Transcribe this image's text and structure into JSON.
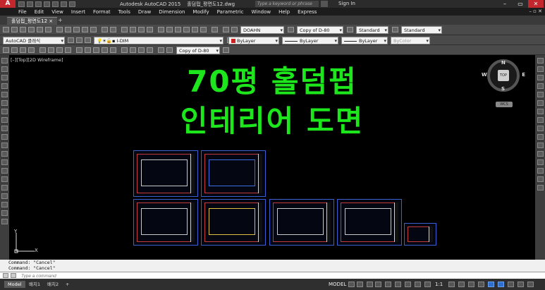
{
  "window": {
    "logo": "A",
    "app_title": "Autodesk AutoCAD 2015",
    "file_name": "홀덤펍_평면도12.dwg",
    "search_placeholder": "Type a keyword or phrase",
    "sign_in": "Sign In",
    "minimize": "–",
    "restore": "▭",
    "close": "✕"
  },
  "menu": {
    "items": [
      "File",
      "Edit",
      "View",
      "Insert",
      "Format",
      "Tools",
      "Draw",
      "Dimension",
      "Modify",
      "Parametric",
      "Window",
      "Help",
      "Express"
    ],
    "window_ctrls": "– ▫ ✕"
  },
  "tabs": {
    "active": "홀덤펍_평면도12",
    "close": "×",
    "add": "+"
  },
  "toolbars": {
    "text_style": "DOAHN",
    "dim_style": "Copy of D-80",
    "table_style": "Standard",
    "multileader_style": "Standard",
    "workspace": "AutoCAD 클래식",
    "layer": "I-DIM",
    "color": "ByLayer",
    "linetype": "ByLayer",
    "lineweight": "ByLayer",
    "plot_style": "ByColor",
    "dim_style_2": "Copy of D-80",
    "color_swatch": "#cc2222"
  },
  "viewport": {
    "label": "[–][Top][2D Wireframe]",
    "title_line1": "70평 홀덤펍",
    "title_line2": "인테리어 도면",
    "title_color": "#1de61d"
  },
  "viewcube": {
    "north": "N",
    "south": "S",
    "east": "E",
    "west": "W",
    "face": "TOP",
    "wcs": "WCS"
  },
  "ucs": {
    "y": "Y",
    "x": "X"
  },
  "command": {
    "history": [
      "Command: \"Cancel\"",
      "Command: \"Cancel\""
    ],
    "placeholder": "Type a command"
  },
  "status": {
    "layout_tabs": [
      "Model",
      "배치1",
      "배치2"
    ],
    "add": "+",
    "model_label": "MODEL",
    "scale": "1:1"
  }
}
